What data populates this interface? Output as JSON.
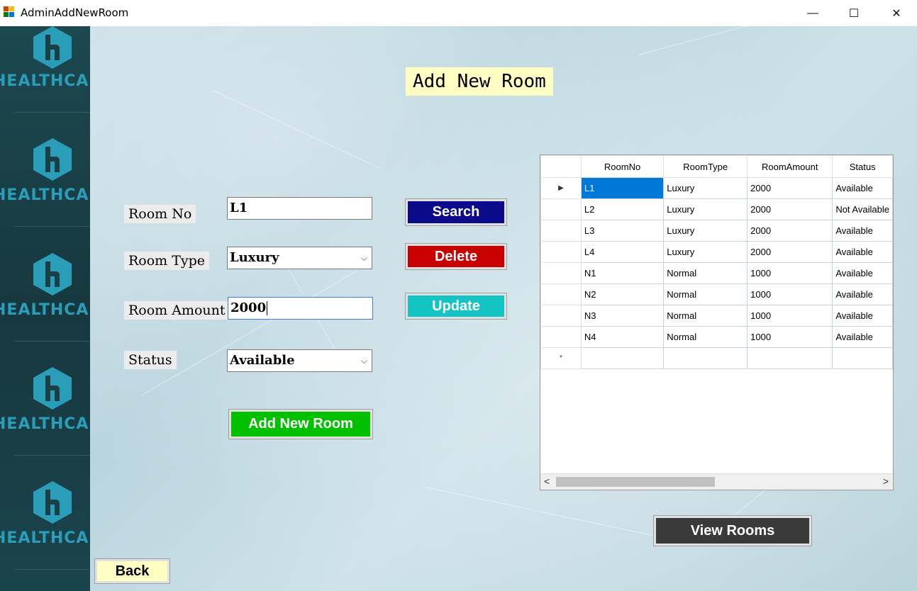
{
  "window": {
    "title": "AdminAddNewRoom",
    "minimize_icon": "—",
    "maximize_icon": "☐",
    "close_icon": "✕"
  },
  "sidebar": {
    "brand_text": "HEALTHCARE",
    "logo_glyph": "h",
    "repeat_count_note": "logo repeated"
  },
  "heading": "Add New Room",
  "form": {
    "room_no_label": "Room No",
    "room_no_value": "L1",
    "room_type_label": "Room Type",
    "room_type_value": "Luxury",
    "room_amount_label": "Room Amount",
    "room_amount_value": "2000",
    "status_label": "Status",
    "status_value": "Available",
    "dropdown_arrow": "⌵"
  },
  "buttons": {
    "search": "Search",
    "delete": "Delete",
    "update": "Update",
    "add_new_room": "Add New Room",
    "view_rooms": "View Rooms",
    "back": "Back"
  },
  "colors": {
    "search": "#0a0a8a",
    "delete": "#c80000",
    "update": "#14c4c4",
    "add_new_room": "#00c000",
    "view_rooms": "#3a3a3a",
    "back": "#ffffc4"
  },
  "grid": {
    "columns": [
      "RoomNo",
      "RoomType",
      "RoomAmount",
      "Status"
    ],
    "rows": [
      [
        "L1",
        "Luxury",
        "2000",
        "Available"
      ],
      [
        "L2",
        "Luxury",
        "2000",
        "Not Available"
      ],
      [
        "L3",
        "Luxury",
        "2000",
        "Available"
      ],
      [
        "L4",
        "Luxury",
        "2000",
        "Available"
      ],
      [
        "N1",
        "Normal",
        "1000",
        "Available"
      ],
      [
        "N2",
        "Normal",
        "1000",
        "Available"
      ],
      [
        "N3",
        "Normal",
        "1000",
        "Available"
      ],
      [
        "N4",
        "Normal",
        "1000",
        "Available"
      ]
    ],
    "current_row_marker": "▶",
    "new_row_marker": "*",
    "scroll_left": "<",
    "scroll_right": ">"
  }
}
